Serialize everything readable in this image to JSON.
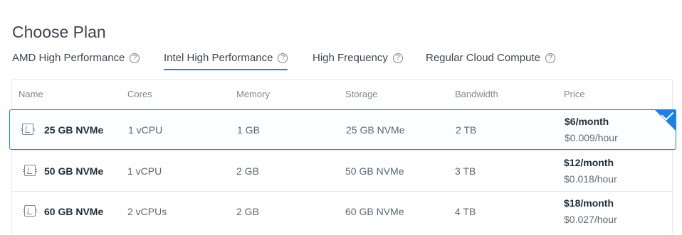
{
  "header": {
    "title": "Choose Plan"
  },
  "tabs": [
    {
      "label": "AMD High Performance",
      "icon": "help-circle-icon",
      "active": false
    },
    {
      "label": "Intel High Performance",
      "icon": "help-circle-icon",
      "active": true
    },
    {
      "label": "High Frequency",
      "icon": "help-circle-icon",
      "active": false
    },
    {
      "label": "Regular Cloud Compute",
      "icon": "help-circle-icon",
      "active": false
    }
  ],
  "table": {
    "columns": [
      "Name",
      "Cores",
      "Memory",
      "Storage",
      "Bandwidth",
      "Price"
    ],
    "rows": [
      {
        "name": "25 GB NVMe",
        "cores": "1 vCPU",
        "memory": "1 GB",
        "storage": "25 GB NVMe",
        "bandwidth": "2 TB",
        "price_month": "$6/month",
        "price_hour": "$0.009/hour",
        "selected": true,
        "icon": "cpu-chip-icon"
      },
      {
        "name": "50 GB NVMe",
        "cores": "1 vCPU",
        "memory": "2 GB",
        "storage": "50 GB NVMe",
        "bandwidth": "3 TB",
        "price_month": "$12/month",
        "price_hour": "$0.018/hour",
        "selected": false,
        "icon": "cpu-chip-icon"
      },
      {
        "name": "60 GB NVMe",
        "cores": "2 vCPUs",
        "memory": "2 GB",
        "storage": "60 GB NVMe",
        "bandwidth": "4 TB",
        "price_month": "$18/month",
        "price_hour": "$0.027/hour",
        "selected": false,
        "icon": "cpu-chip-icon"
      }
    ]
  },
  "colors": {
    "accent": "#1e80e6",
    "border": "#e5e9ee",
    "text": "#3d4650"
  },
  "icons": {
    "selected_indicator": "check-icon"
  }
}
